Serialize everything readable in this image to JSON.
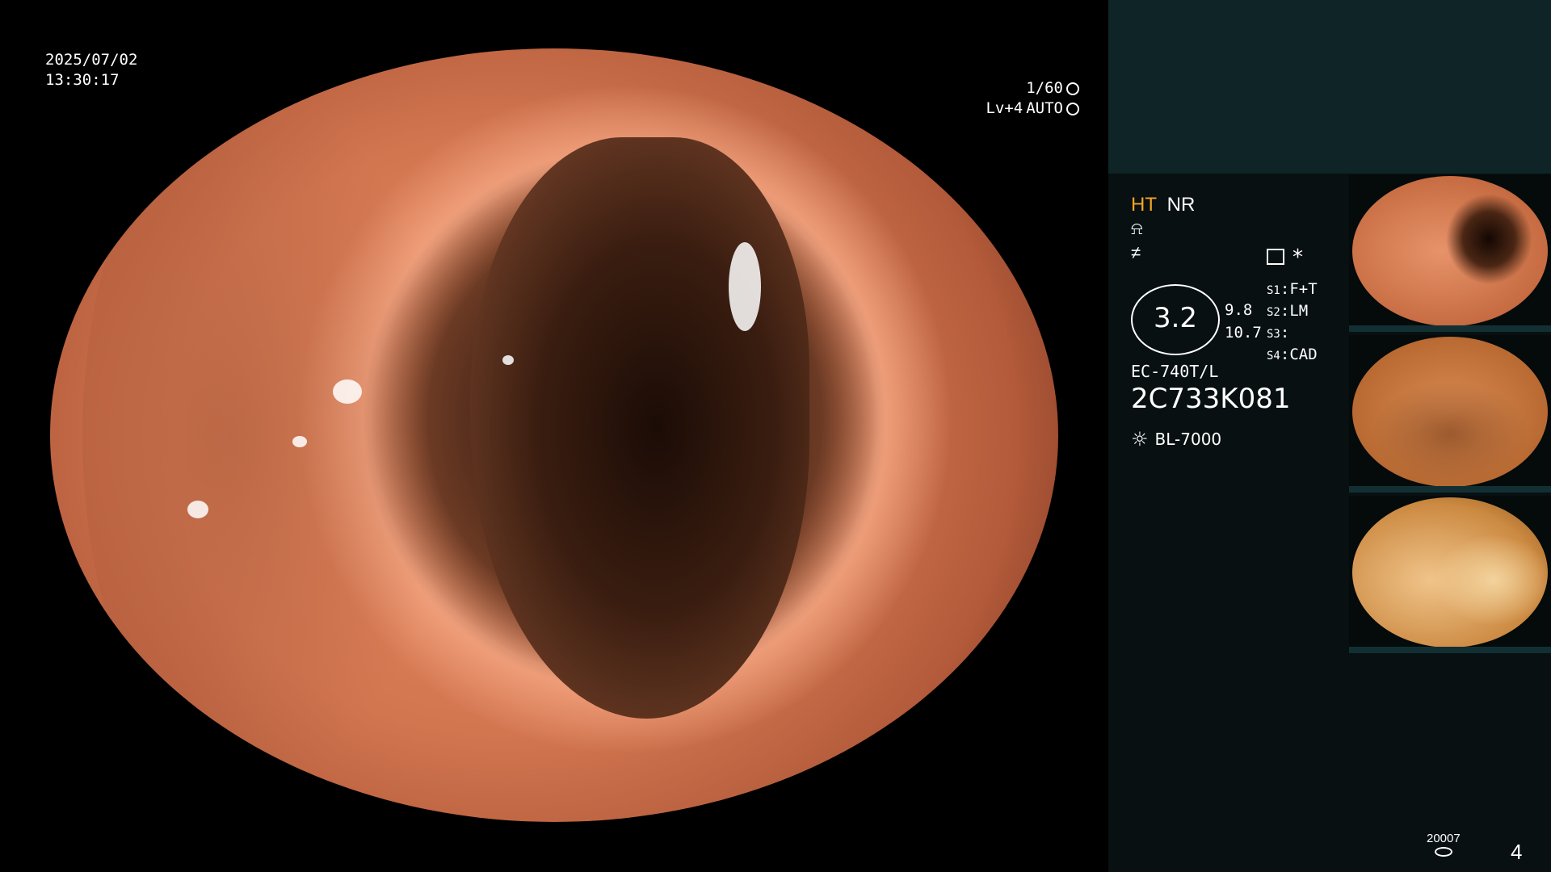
{
  "osd": {
    "date": "2025/07/02",
    "time": "13:30:17",
    "shutter": "1/60",
    "shutter_icon": "aperture-icon",
    "level": "Lv+4",
    "exposure_mode": "AUTO",
    "exposure_icon": "iris-icon"
  },
  "panel": {
    "mode_ht": "HT",
    "mode_nr": "NR",
    "enhancement_glyph_1": "⍾",
    "enhancement_glyph_2": "≠",
    "menu_icon": "menu-icon",
    "star_label": "*",
    "zoom_main": "3.2",
    "zoom_sub_1": "9.8",
    "zoom_sub_2": "10.7",
    "switches": [
      {
        "key": "S1",
        "value": "F+T"
      },
      {
        "key": "S2",
        "value": "LM"
      },
      {
        "key": "S3",
        "value": ""
      },
      {
        "key": "S4",
        "value": "CAD"
      }
    ],
    "scope_model": "EC-740T/L",
    "scope_serial": "2C733K081",
    "light_icon": "sun-icon",
    "light_source": "BL-7000"
  },
  "thumbnails": [
    {
      "name": "capture-1"
    },
    {
      "name": "capture-2"
    },
    {
      "name": "capture-3"
    }
  ],
  "footer": {
    "record_code": "20007",
    "page_number": "4"
  },
  "colors": {
    "accent_ht": "#f5a622",
    "panel_top": "#0e2427",
    "panel_bg": "#081012"
  }
}
